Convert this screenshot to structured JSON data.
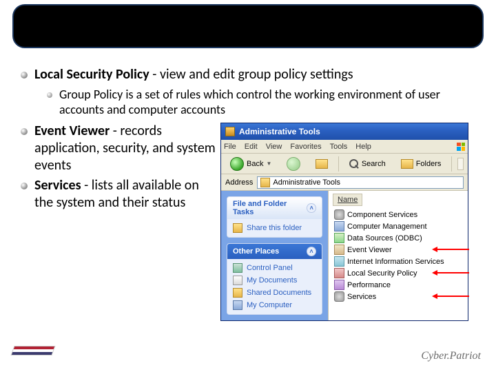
{
  "header": {
    "title": ""
  },
  "bullets": {
    "lsp_bold": "Local Security Policy",
    "lsp_rest": " - view and edit group policy settings",
    "gp_desc": "Group Policy is a set of rules which control the working environment of user accounts and computer accounts",
    "ev_bold": "Event Viewer",
    "ev_rest": " - records application, security, and system events",
    "svc_bold": "Services",
    "svc_rest": " - lists all available on the system and their status"
  },
  "xp": {
    "title": "Administrative Tools",
    "menus": [
      "File",
      "Edit",
      "View",
      "Favorites",
      "Tools",
      "Help"
    ],
    "toolbar": {
      "back": "Back",
      "search": "Search",
      "folders": "Folders"
    },
    "address_label": "Address",
    "address_value": "Administrative Tools",
    "panel1": {
      "title": "File and Folder Tasks",
      "items": [
        "Share this folder"
      ]
    },
    "panel2": {
      "title": "Other Places",
      "items": [
        "Control Panel",
        "My Documents",
        "Shared Documents",
        "My Computer"
      ]
    },
    "col_header": "Name",
    "list": [
      "Component Services",
      "Computer Management",
      "Data Sources (ODBC)",
      "Event Viewer",
      "Internet Information Services",
      "Local Security Policy",
      "Performance",
      "Services"
    ]
  },
  "footer": {
    "brand": "Cyber.Patriot"
  }
}
